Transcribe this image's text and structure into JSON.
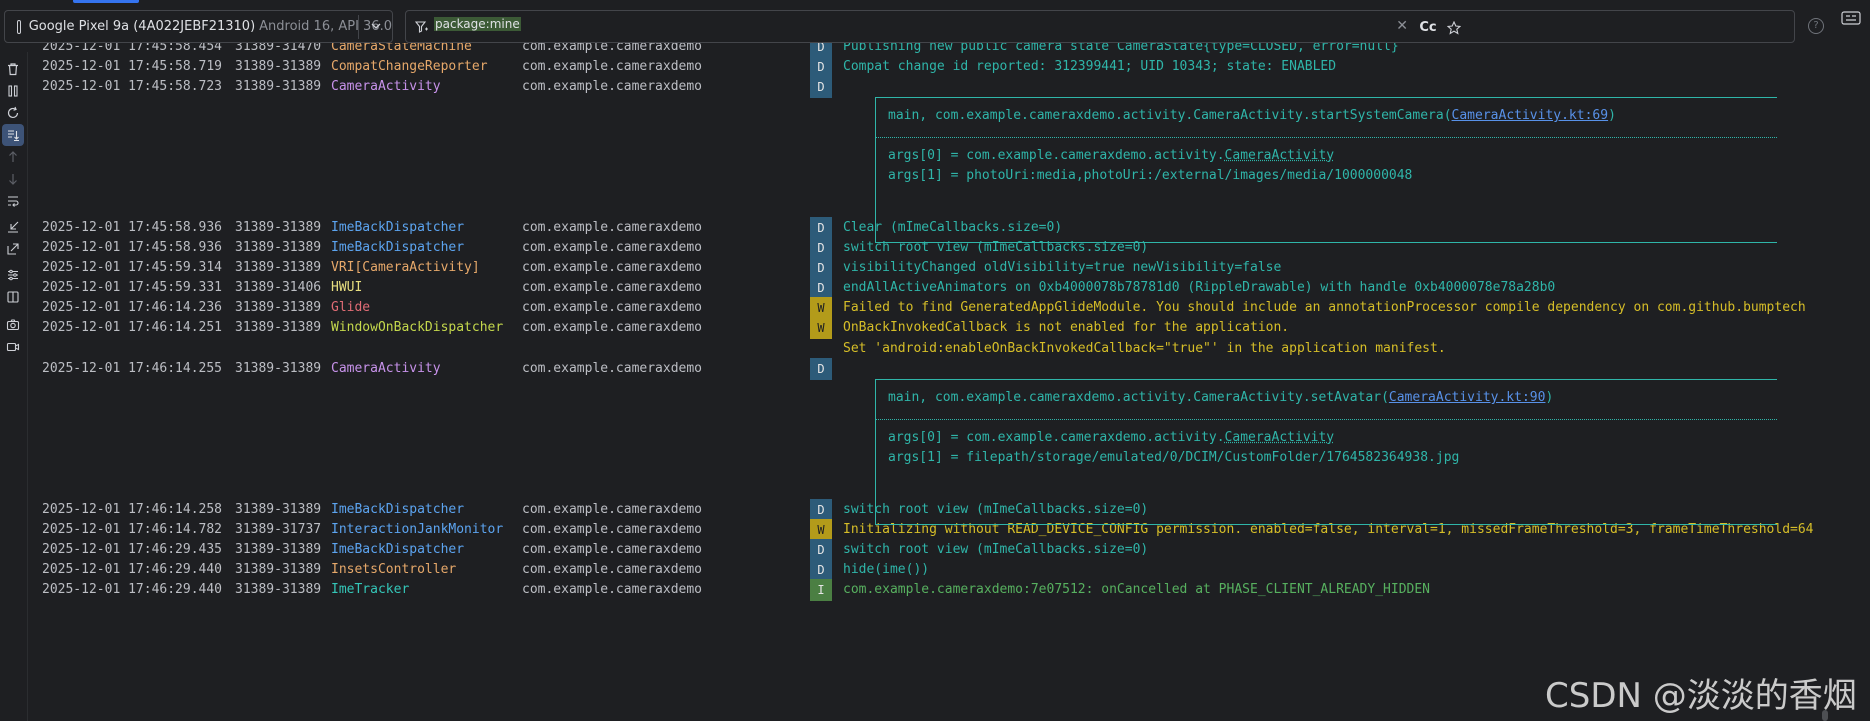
{
  "device": {
    "name": "Google Pixel 9a (4A022JEBF21310)",
    "api": "Android 16, API 36.0"
  },
  "filter": {
    "query": "package:mine",
    "clear_glyph": "✕",
    "case_label": "Cc",
    "star_glyph": "☆",
    "help_glyph": "?"
  },
  "toolbar": {
    "icons": [
      "trash-icon",
      "pause-icon",
      "restart-icon",
      "scroll-to-end-icon",
      "up-icon",
      "down-icon",
      "soft-wrap-icon",
      "import-icon",
      "export-icon",
      "settings-icon",
      "split-icon",
      "screenshot-icon",
      "screen-record-icon"
    ]
  },
  "colors": {
    "tag_orange": "#e6a86a",
    "tag_blue": "#5ca4f0",
    "tag_purple": "#c792ea",
    "tag_red": "#e06c75",
    "tag_yellow": "#e8df80",
    "tag_teal": "#34c6b8",
    "tag_green_yellow": "#c4d84c"
  },
  "log": {
    "rows": [
      {
        "time": "2025-12-01 17:45:58.454",
        "pid": "31389-31470",
        "tag": "CameraStateMachine",
        "tag_color": "#e6a86a",
        "pkg": "com.example.cameraxdemo",
        "level": "D",
        "msg": "Publishing new public camera state CameraState{type=CLOSED, error=null}"
      },
      {
        "time": "2025-12-01 17:45:58.719",
        "pid": "31389-31389",
        "tag": "CompatChangeReporter",
        "tag_color": "#e6a86a",
        "pkg": "com.example.cameraxdemo",
        "level": "D",
        "msg": "Compat change id reported: 312399441; UID 10343; state: ENABLED"
      },
      {
        "time": "2025-12-01 17:45:58.723",
        "pid": "31389-31389",
        "tag": "CameraActivity",
        "tag_color": "#c792ea",
        "pkg": "com.example.cameraxdemo",
        "level": "D",
        "msg": ""
      },
      {
        "time": "2025-12-01 17:45:58.936",
        "pid": "31389-31389",
        "tag": "ImeBackDispatcher",
        "tag_color": "#5ca4f0",
        "pkg": "com.example.cameraxdemo",
        "level": "D",
        "msg": "Clear (mImeCallbacks.size=0)"
      },
      {
        "time": "2025-12-01 17:45:58.936",
        "pid": "31389-31389",
        "tag": "ImeBackDispatcher",
        "tag_color": "#5ca4f0",
        "pkg": "com.example.cameraxdemo",
        "level": "D",
        "msg": "switch root view (mImeCallbacks.size=0)"
      },
      {
        "time": "2025-12-01 17:45:59.314",
        "pid": "31389-31389",
        "tag": "VRI[CameraActivity]",
        "tag_color": "#e6a86a",
        "pkg": "com.example.cameraxdemo",
        "level": "D",
        "msg": "visibilityChanged oldVisibility=true newVisibility=false"
      },
      {
        "time": "2025-12-01 17:45:59.331",
        "pid": "31389-31406",
        "tag": "HWUI",
        "tag_color": "#e8df80",
        "pkg": "com.example.cameraxdemo",
        "level": "D",
        "msg": "endAllActiveAnimators on 0xb4000078b78781d0 (RippleDrawable) with handle 0xb4000078e78a28b0"
      },
      {
        "time": "2025-12-01 17:46:14.236",
        "pid": "31389-31389",
        "tag": "Glide",
        "tag_color": "#e06c75",
        "pkg": "com.example.cameraxdemo",
        "level": "W",
        "msg": "Failed to find GeneratedAppGlideModule. You should include an annotationProcessor compile dependency on com.github.bumptech"
      },
      {
        "time": "2025-12-01 17:46:14.251",
        "pid": "31389-31389",
        "tag": "WindowOnBackDispatcher",
        "tag_color": "#c4d84c",
        "pkg": "com.example.cameraxdemo",
        "level": "W",
        "msg": "OnBackInvokedCallback is not enabled for the application."
      },
      {
        "time": "",
        "pid": "",
        "tag": "",
        "tag_color": "#c4d84c",
        "pkg": "",
        "level": "",
        "msg": "Set 'android:enableOnBackInvokedCallback=\"true\"' in the application manifest.",
        "msg_level": "W"
      },
      {
        "time": "2025-12-01 17:46:14.255",
        "pid": "31389-31389",
        "tag": "CameraActivity",
        "tag_color": "#c792ea",
        "pkg": "com.example.cameraxdemo",
        "level": "D",
        "msg": ""
      },
      {
        "time": "2025-12-01 17:46:14.258",
        "pid": "31389-31389",
        "tag": "ImeBackDispatcher",
        "tag_color": "#5ca4f0",
        "pkg": "com.example.cameraxdemo",
        "level": "D",
        "msg": "switch root view (mImeCallbacks.size=0)"
      },
      {
        "time": "2025-12-01 17:46:14.782",
        "pid": "31389-31737",
        "tag": "InteractionJankMonitor",
        "tag_color": "#5ca4f0",
        "pkg": "com.example.cameraxdemo",
        "level": "W",
        "msg": "Initializing without READ_DEVICE_CONFIG permission. enabled=false, interval=1, missedFrameThreshold=3, frameTimeThreshold=64"
      },
      {
        "time": "2025-12-01 17:46:29.435",
        "pid": "31389-31389",
        "tag": "ImeBackDispatcher",
        "tag_color": "#5ca4f0",
        "pkg": "com.example.cameraxdemo",
        "level": "D",
        "msg": "switch root view (mImeCallbacks.size=0)"
      },
      {
        "time": "2025-12-01 17:46:29.440",
        "pid": "31389-31389",
        "tag": "InsetsController",
        "tag_color": "#e6a86a",
        "pkg": "com.example.cameraxdemo",
        "level": "D",
        "msg": "hide(ime())"
      },
      {
        "time": "2025-12-01 17:46:29.440",
        "pid": "31389-31389",
        "tag": "ImeTracker",
        "tag_color": "#34c6b8",
        "pkg": "com.example.cameraxdemo",
        "level": "I",
        "msg": "com.example.cameraxdemo:7e07512: onCancelled at PHASE_CLIENT_ALREADY_HIDDEN"
      }
    ],
    "boxes": [
      {
        "line1_prefix": "main, com.example.cameraxdemo.activity.CameraActivity.startSystemCamera(",
        "line1_link": "CameraActivity.kt:69",
        "line1_suffix": ")",
        "arg0_prefix": "args[0] = com.example.cameraxdemo.activity.",
        "arg0_link": "CameraActivity",
        "arg1": "args[1] = photoUri:media,photoUri:/external/images/media/1000000048"
      },
      {
        "line1_prefix": "main, com.example.cameraxdemo.activity.CameraActivity.setAvatar(",
        "line1_link": "CameraActivity.kt:90",
        "line1_suffix": ")",
        "arg0_prefix": "args[0] = com.example.cameraxdemo.activity.",
        "arg0_link": "CameraActivity",
        "arg1": "args[1] = filepath/storage/emulated/0/DCIM/CustomFolder/1764582364938.jpg"
      }
    ]
  },
  "watermark": "CSDN @淡淡的香烟"
}
